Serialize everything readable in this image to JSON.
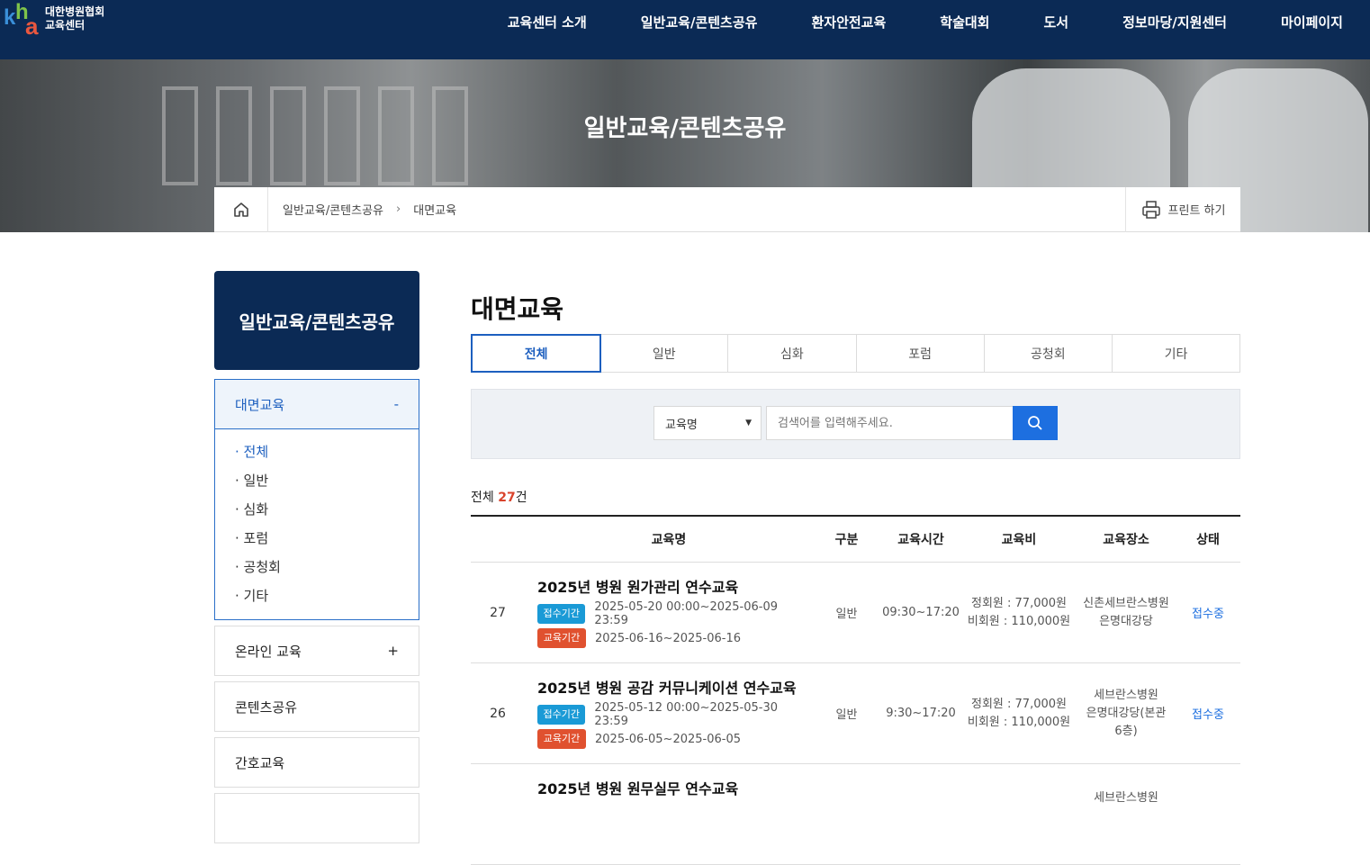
{
  "header": {
    "logo_line1": "대한병원협회",
    "logo_line2": "교육센터",
    "menu": [
      "교육센터 소개",
      "일반교육/콘텐츠공유",
      "환자안전교육",
      "학술대회",
      "도서",
      "정보마당/지원센터",
      "마이페이지"
    ]
  },
  "banner": {
    "title": "일반교육/콘텐츠공유"
  },
  "breadcrumb": {
    "level1": "일반교육/콘텐츠공유",
    "sep": "›",
    "level2": "대면교육",
    "print": "프린트 하기"
  },
  "sidebar": {
    "title": "일반교육/콘텐츠공유",
    "active": {
      "label": "대면교육",
      "toggle": "-"
    },
    "sub_items": [
      "· 전체",
      "· 일반",
      "· 심화",
      "· 포럼",
      "· 공청회",
      "· 기타"
    ],
    "items": [
      {
        "label": "온라인 교육",
        "toggle": "+"
      },
      {
        "label": "콘텐츠공유",
        "toggle": ""
      },
      {
        "label": "간호교육",
        "toggle": ""
      }
    ]
  },
  "main": {
    "title": "대면교육",
    "tabs": [
      "전체",
      "일반",
      "심화",
      "포럼",
      "공청회",
      "기타"
    ],
    "search": {
      "select_value": "교육명",
      "placeholder": "검색어를 입력해주세요."
    },
    "total": {
      "prefix": "전체 ",
      "count": "27",
      "suffix": "건"
    },
    "table": {
      "headers": [
        "교육명",
        "구분",
        "교육시간",
        "교육비",
        "교육장소",
        "상태"
      ],
      "rows": [
        {
          "no": "27",
          "title": "2025년 병원 원가관리 연수교육",
          "apply_label": "접수기간",
          "apply_period": "2025-05-20 00:00~2025-06-09 23:59",
          "edu_label": "교육기간",
          "edu_period": "2025-06-16~2025-06-16",
          "category": "일반",
          "time": "09:30~17:20",
          "fee_member": "정회원 : 77,000원",
          "fee_nonmember": "비회원 : 110,000원",
          "place": [
            "신촌세브란스병원",
            "은명대강당"
          ],
          "status": "접수중"
        },
        {
          "no": "26",
          "title": "2025년 병원 공감 커뮤니케이션 연수교육",
          "apply_label": "접수기간",
          "apply_period": "2025-05-12 00:00~2025-05-30 23:59",
          "edu_label": "교육기간",
          "edu_period": "2025-06-05~2025-06-05",
          "category": "일반",
          "time": "9:30~17:20",
          "fee_member": "정회원 : 77,000원",
          "fee_nonmember": "비회원 : 110,000원",
          "place": [
            "세브란스병원",
            "은명대강당(본관",
            "6층)"
          ],
          "status": "접수중"
        },
        {
          "no": "",
          "title": "2025년 병원 원무실무 연수교육",
          "place": [
            "세브란스병원"
          ]
        }
      ]
    }
  },
  "colors": {
    "navy": "#0b2a55",
    "accent_blue": "#1d5fbf",
    "badge_blue": "#1a9ad6",
    "badge_red": "#e0512f",
    "count_red": "#d9432c"
  }
}
